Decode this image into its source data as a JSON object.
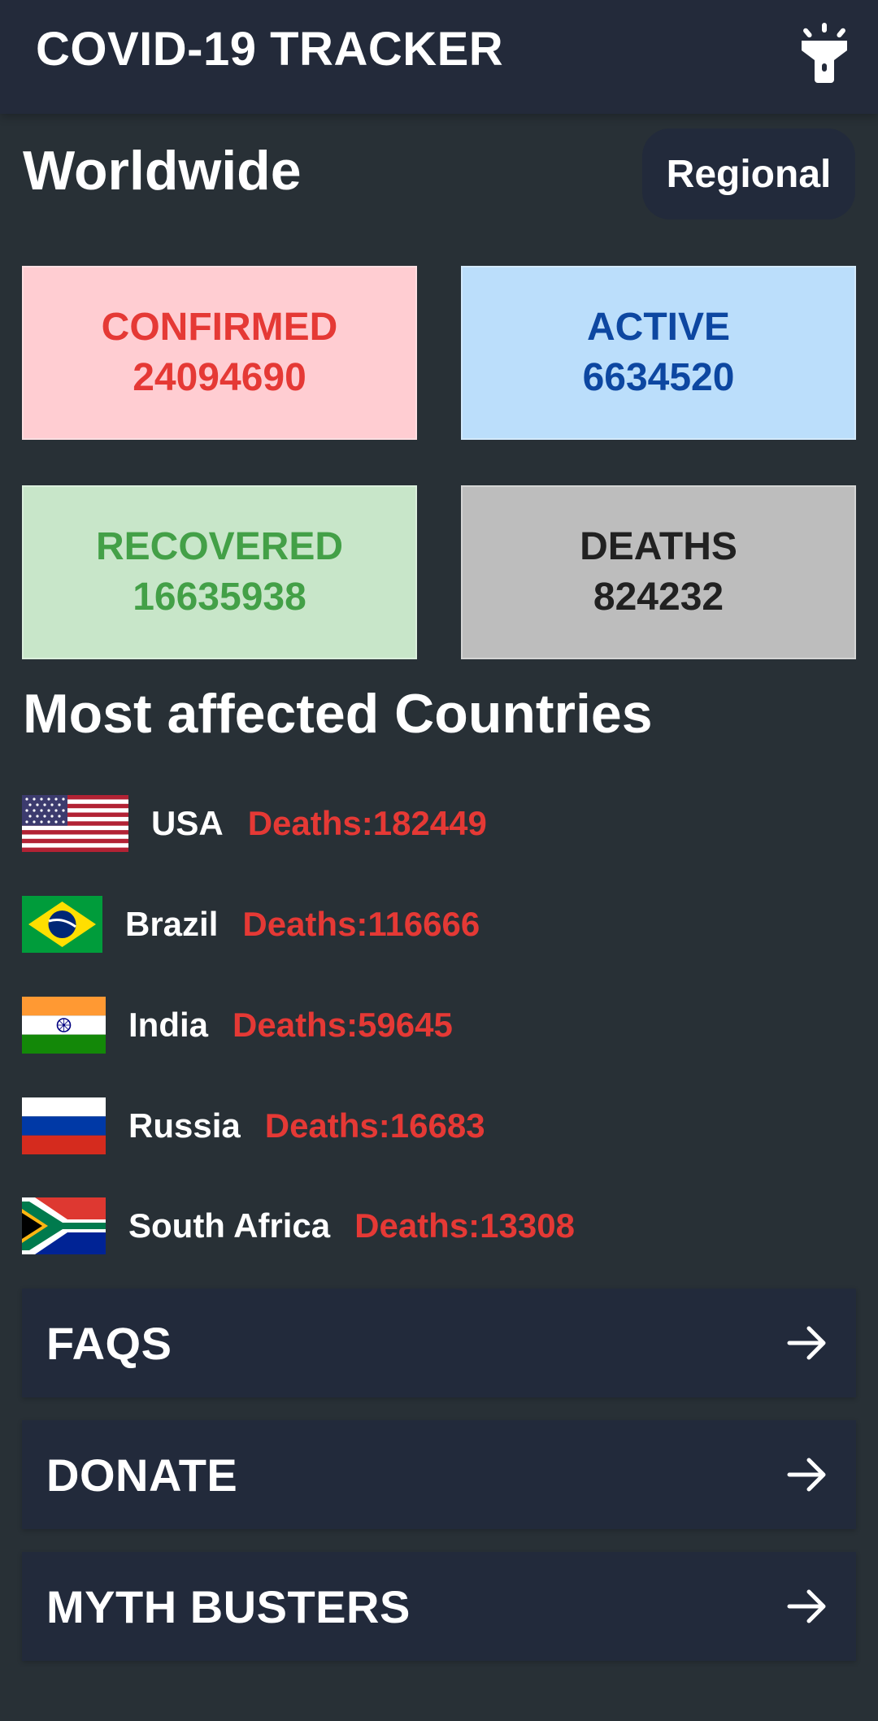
{
  "app": {
    "title": "COVID-19 TRACKER",
    "theme_toggle_icon": "flashlight-icon"
  },
  "worldwide": {
    "title": "Worldwide",
    "regional_button": "Regional",
    "cards": {
      "confirmed": {
        "label": "CONFIRMED",
        "value": "24094690",
        "bg": "#ffcdd2",
        "color": "#e53935"
      },
      "active": {
        "label": "ACTIVE",
        "value": "6634520",
        "bg": "#bbdefb",
        "color": "#0d47a1"
      },
      "recovered": {
        "label": "RECOVERED",
        "value": "16635938",
        "bg": "#c8e6c9",
        "color": "#43a047"
      },
      "deaths": {
        "label": "DEATHS",
        "value": "824232",
        "bg": "#bdbdbd",
        "color": "#212121"
      }
    }
  },
  "most_affected": {
    "title": "Most affected Countries",
    "countries": [
      {
        "name": "USA",
        "deaths": "Deaths:182449",
        "flag_icon": "usa-flag-icon"
      },
      {
        "name": "Brazil",
        "deaths": "Deaths:116666",
        "flag_icon": "brazil-flag-icon"
      },
      {
        "name": "India",
        "deaths": "Deaths:59645",
        "flag_icon": "india-flag-icon"
      },
      {
        "name": "Russia",
        "deaths": "Deaths:16683",
        "flag_icon": "russia-flag-icon"
      },
      {
        "name": "South Africa",
        "deaths": "Deaths:13308",
        "flag_icon": "south-africa-flag-icon"
      }
    ]
  },
  "nav": [
    {
      "label": "FAQS",
      "icon": "arrow-right-icon"
    },
    {
      "label": "DONATE",
      "icon": "arrow-right-icon"
    },
    {
      "label": "MYTH BUSTERS",
      "icon": "arrow-right-icon"
    }
  ],
  "colors": {
    "background": "#283036",
    "appbar": "#232a3a",
    "panel": "#222a3b",
    "deaths_text": "#e53935"
  }
}
